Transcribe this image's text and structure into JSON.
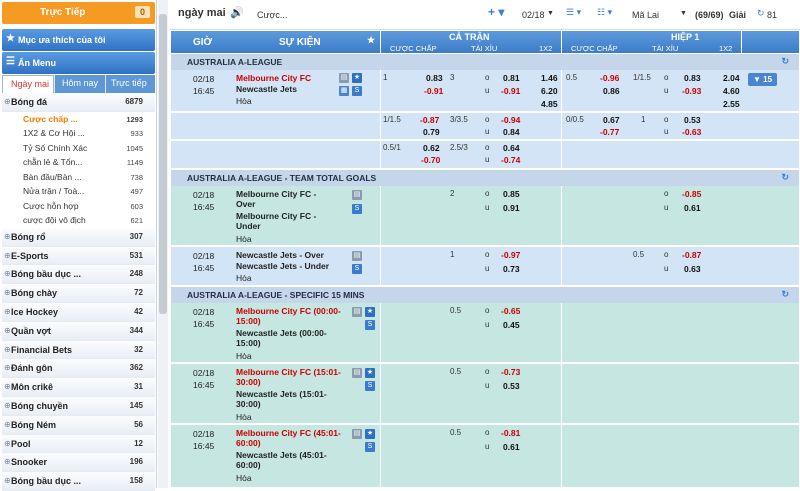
{
  "sidebar": {
    "live": {
      "label": "Trực Tiếp",
      "count": "0"
    },
    "favorites": "Mục ưa thích của tôi",
    "hide_menu": "Ẩn Menu",
    "tabs": [
      "Ngày mai",
      "Hôm nay",
      "Trực tiếp"
    ],
    "football": {
      "name": "Bóng đá",
      "count": "6879"
    },
    "subitems": [
      {
        "name": "Cược chấp ...",
        "count": "1293"
      },
      {
        "name": "1X2 & Cơ Hội ...",
        "count": "933"
      },
      {
        "name": "Tỷ Số Chính Xác",
        "count": "1045"
      },
      {
        "name": "chẵn lẻ & Tổn...",
        "count": "1149"
      },
      {
        "name": "Bàn đầu/Bàn ...",
        "count": "738"
      },
      {
        "name": "Nửa trận / Toà...",
        "count": "497"
      },
      {
        "name": "Cược hỗn hợp",
        "count": "603"
      },
      {
        "name": "cược đội vô địch",
        "count": "621"
      }
    ],
    "sports": [
      {
        "name": "Bóng rổ",
        "count": "307"
      },
      {
        "name": "E-Sports",
        "count": "531"
      },
      {
        "name": "Bóng bầu dục ...",
        "count": "248"
      },
      {
        "name": "Bóng chày",
        "count": "72"
      },
      {
        "name": "Ice Hockey",
        "count": "42"
      },
      {
        "name": "Quần vợt",
        "count": "344"
      },
      {
        "name": "Financial Bets",
        "count": "32"
      },
      {
        "name": "Đánh gôn",
        "count": "362"
      },
      {
        "name": "Môn crikê",
        "count": "31"
      },
      {
        "name": "Bóng chuyền",
        "count": "145"
      },
      {
        "name": "Bóng Ném",
        "count": "56"
      },
      {
        "name": "Pool",
        "count": "12"
      },
      {
        "name": "Snooker",
        "count": "196"
      },
      {
        "name": "Bóng bầu dục ...",
        "count": "158"
      }
    ]
  },
  "toolbar": {
    "day": "ngày mai",
    "bet_type": "Cược...",
    "date": "02/18",
    "odds_type": "Mã Lai",
    "count": "(69/69)",
    "count_suffix": "Giải",
    "refresh": "81"
  },
  "header": {
    "time": "GIỜ",
    "event": "SỰ KIỆN",
    "full": "CẢ TRẬN",
    "half": "HIỆP 1",
    "hdp": "CƯỢC CHẤP",
    "ou": "TÀI XỈU",
    "x12": "1X2",
    "hdp2": "CƯỢC CHẤP",
    "ou2": "TÀI XỈU",
    "x122": "1X2"
  },
  "leagues": [
    {
      "name": "AUSTRALIA A-LEAGUE"
    },
    {
      "name": "AUSTRALIA A-LEAGUE - TEAM TOTAL GOALS"
    },
    {
      "name": "AUSTRALIA A-LEAGUE - SPECIFIC 15 MINS"
    }
  ],
  "match1": {
    "date": "02/18",
    "time": "16:45",
    "home": "Melbourne City FC",
    "away": "Newcastle Jets",
    "draw": "Hòa",
    "more": "▼ 15",
    "l1": {
      "hdp": "1",
      "h": "0.83",
      "a": "-0.91",
      "ou": "3",
      "o": "o",
      "u": "u",
      "ov": "0.81",
      "uv": "-0.91",
      "x1": "1.46",
      "xx": "6.20",
      "x2": "4.85",
      "hhdp": "0.5",
      "hh": "-0.96",
      "ha": "0.86",
      "hou": "1/1.5",
      "hov": "0.83",
      "huv": "-0.93",
      "hx1": "2.04",
      "hxx": "4.60",
      "hx2": "2.55"
    },
    "l2": {
      "hdp": "1/1.5",
      "h": "-0.87",
      "a": "0.79",
      "ou": "3/3.5",
      "ov": "-0.94",
      "uv": "0.84",
      "hhdp": "0/0.5",
      "hh": "0.67",
      "ha": "-0.77",
      "hou": "1",
      "hov": "0.53",
      "huv": "-0.63"
    },
    "l3": {
      "hdp": "0.5/1",
      "h": "0.62",
      "a": "-0.70",
      "ou": "2.5/3",
      "ov": "0.64",
      "uv": "-0.74"
    }
  },
  "ttg1": {
    "date": "02/18",
    "time": "16:45",
    "home": "Melbourne City FC - Over",
    "away": "Melbourne City FC - Under",
    "draw": "Hòa",
    "ou": "2",
    "ov": "0.85",
    "uv": "0.91",
    "hov": "-0.85",
    "huv": "0.61"
  },
  "ttg2": {
    "date": "02/18",
    "time": "16:45",
    "home": "Newcastle Jets - Over",
    "away": "Newcastle Jets - Under",
    "draw": "Hòa",
    "ou": "1",
    "ov": "-0.97",
    "uv": "0.73",
    "hou": "0.5",
    "hov": "-0.87",
    "huv": "0.63"
  },
  "m15": [
    {
      "date": "02/18",
      "time": "16:45",
      "home": "Melbourne City FC (00:00-15:00)",
      "away": "Newcastle Jets (00:00-15:00)",
      "draw": "Hòa",
      "ou": "0.5",
      "ov": "-0.65",
      "uv": "0.45"
    },
    {
      "date": "02/18",
      "time": "16:45",
      "home": "Melbourne City FC (15:01-30:00)",
      "away": "Newcastle Jets (15:01-30:00)",
      "draw": "Hòa",
      "ou": "0.5",
      "ov": "-0.73",
      "uv": "0.53"
    },
    {
      "date": "02/18",
      "time": "16:45",
      "home": "Melbourne City FC (45:01-60:00)",
      "away": "Newcastle Jets (45:01-60:00)",
      "draw": "Hòa",
      "ou": "0.5",
      "ov": "-0.81",
      "uv": "0.61"
    }
  ],
  "ou_labels": {
    "o": "o",
    "u": "u"
  }
}
